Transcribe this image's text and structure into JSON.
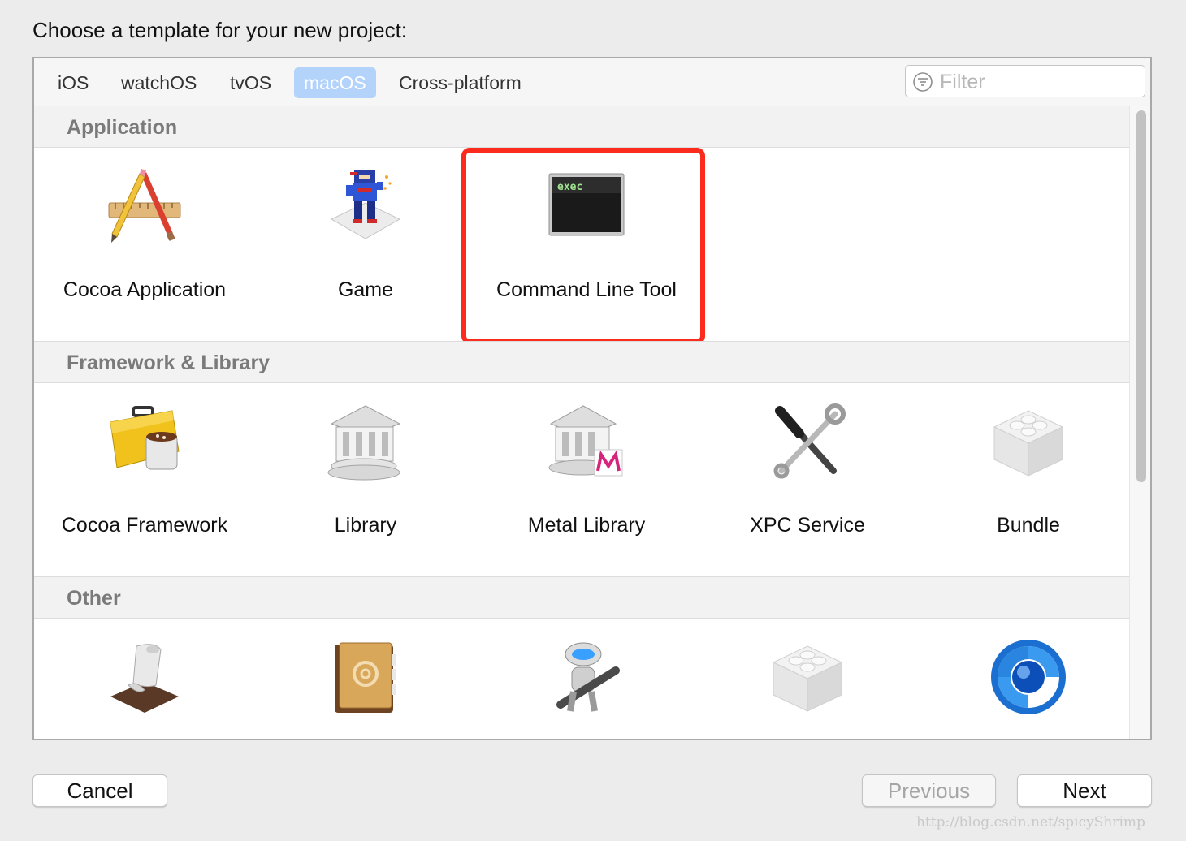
{
  "prompt": "Choose a template for your new project:",
  "tabs": [
    {
      "label": "iOS",
      "active": false
    },
    {
      "label": "watchOS",
      "active": false
    },
    {
      "label": "tvOS",
      "active": false
    },
    {
      "label": "macOS",
      "active": true
    },
    {
      "label": "Cross-platform",
      "active": false
    }
  ],
  "filter": {
    "placeholder": "Filter",
    "value": ""
  },
  "sections": [
    {
      "title": "Application",
      "items": [
        {
          "label": "Cocoa Application",
          "icon": "cocoa-app-icon"
        },
        {
          "label": "Game",
          "icon": "game-icon"
        },
        {
          "label": "Command Line Tool",
          "icon": "terminal-icon",
          "highlighted": true
        }
      ]
    },
    {
      "title": "Framework & Library",
      "items": [
        {
          "label": "Cocoa Framework",
          "icon": "cocoa-framework-icon"
        },
        {
          "label": "Library",
          "icon": "library-icon"
        },
        {
          "label": "Metal Library",
          "icon": "metal-library-icon"
        },
        {
          "label": "XPC Service",
          "icon": "xpc-service-icon"
        },
        {
          "label": "Bundle",
          "icon": "bundle-icon"
        }
      ]
    },
    {
      "title": "Other",
      "items": [
        {
          "icon": "script-icon"
        },
        {
          "icon": "address-book-icon"
        },
        {
          "icon": "automator-icon"
        },
        {
          "icon": "plugin-icon"
        },
        {
          "icon": "quartz-icon"
        }
      ]
    }
  ],
  "exec_text": "exec",
  "buttons": {
    "cancel": "Cancel",
    "previous": "Previous",
    "next": "Next"
  },
  "watermark": "http://blog.csdn.net/spicyShrimp",
  "colors": {
    "highlight": "#fb2c1d",
    "active_tab": "#b3d3fb"
  }
}
